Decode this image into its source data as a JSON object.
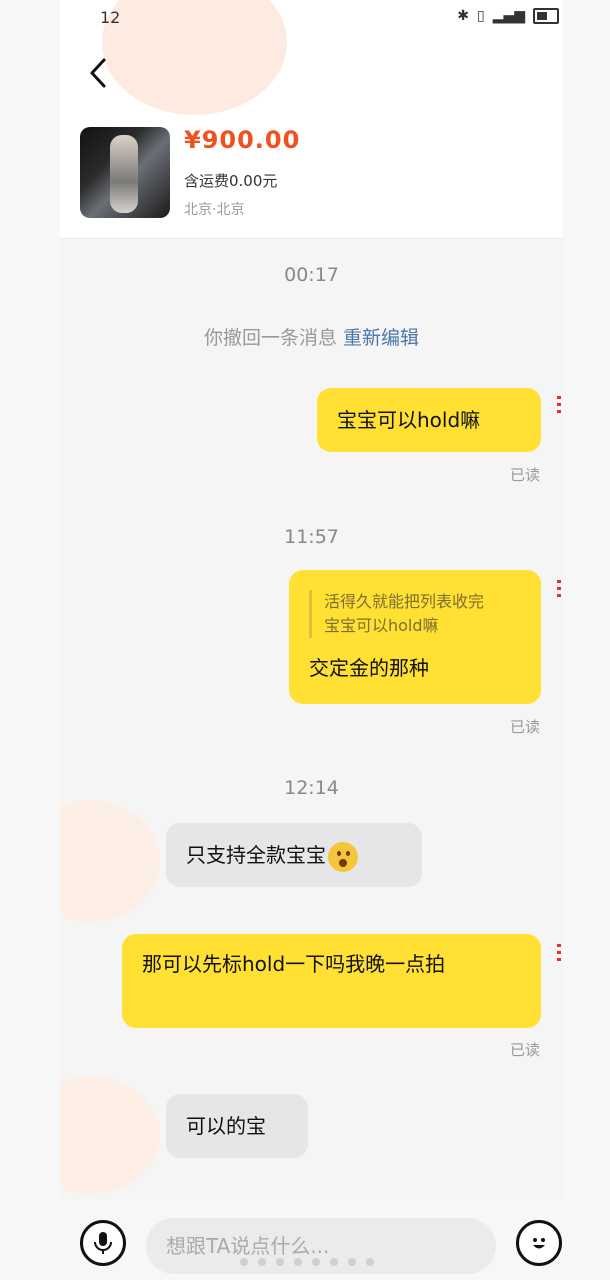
{
  "status_bar": {
    "time": "12"
  },
  "product": {
    "price": "¥900.00",
    "shipping": "含运费0.00元",
    "location": "北京·北京"
  },
  "messages": {
    "time1": "00:17",
    "recall_text": "你撤回一条消息",
    "recall_edit": "重新编辑",
    "msg1": "宝宝可以hold嘛",
    "read1": "已读",
    "time2": "11:57",
    "quote_line1": "活得久就能把列表收完",
    "quote_line2": "宝宝可以hold嘛",
    "msg2": "交定金的那种",
    "read2": "已读",
    "time3": "12:14",
    "msg3": "只支持全款宝宝",
    "msg4": "那可以先标hold一下吗我晚一点拍",
    "read3": "已读",
    "msg5": "可以的宝"
  },
  "input": {
    "placeholder": "想跟TA说点什么..."
  },
  "icons": {
    "back": "back-arrow-icon",
    "mic": "microphone-icon",
    "emoji": "emoji-icon"
  },
  "colors": {
    "accent_yellow": "#ffe033",
    "price_orange": "#f0521f",
    "link_blue": "#4b78a8"
  }
}
